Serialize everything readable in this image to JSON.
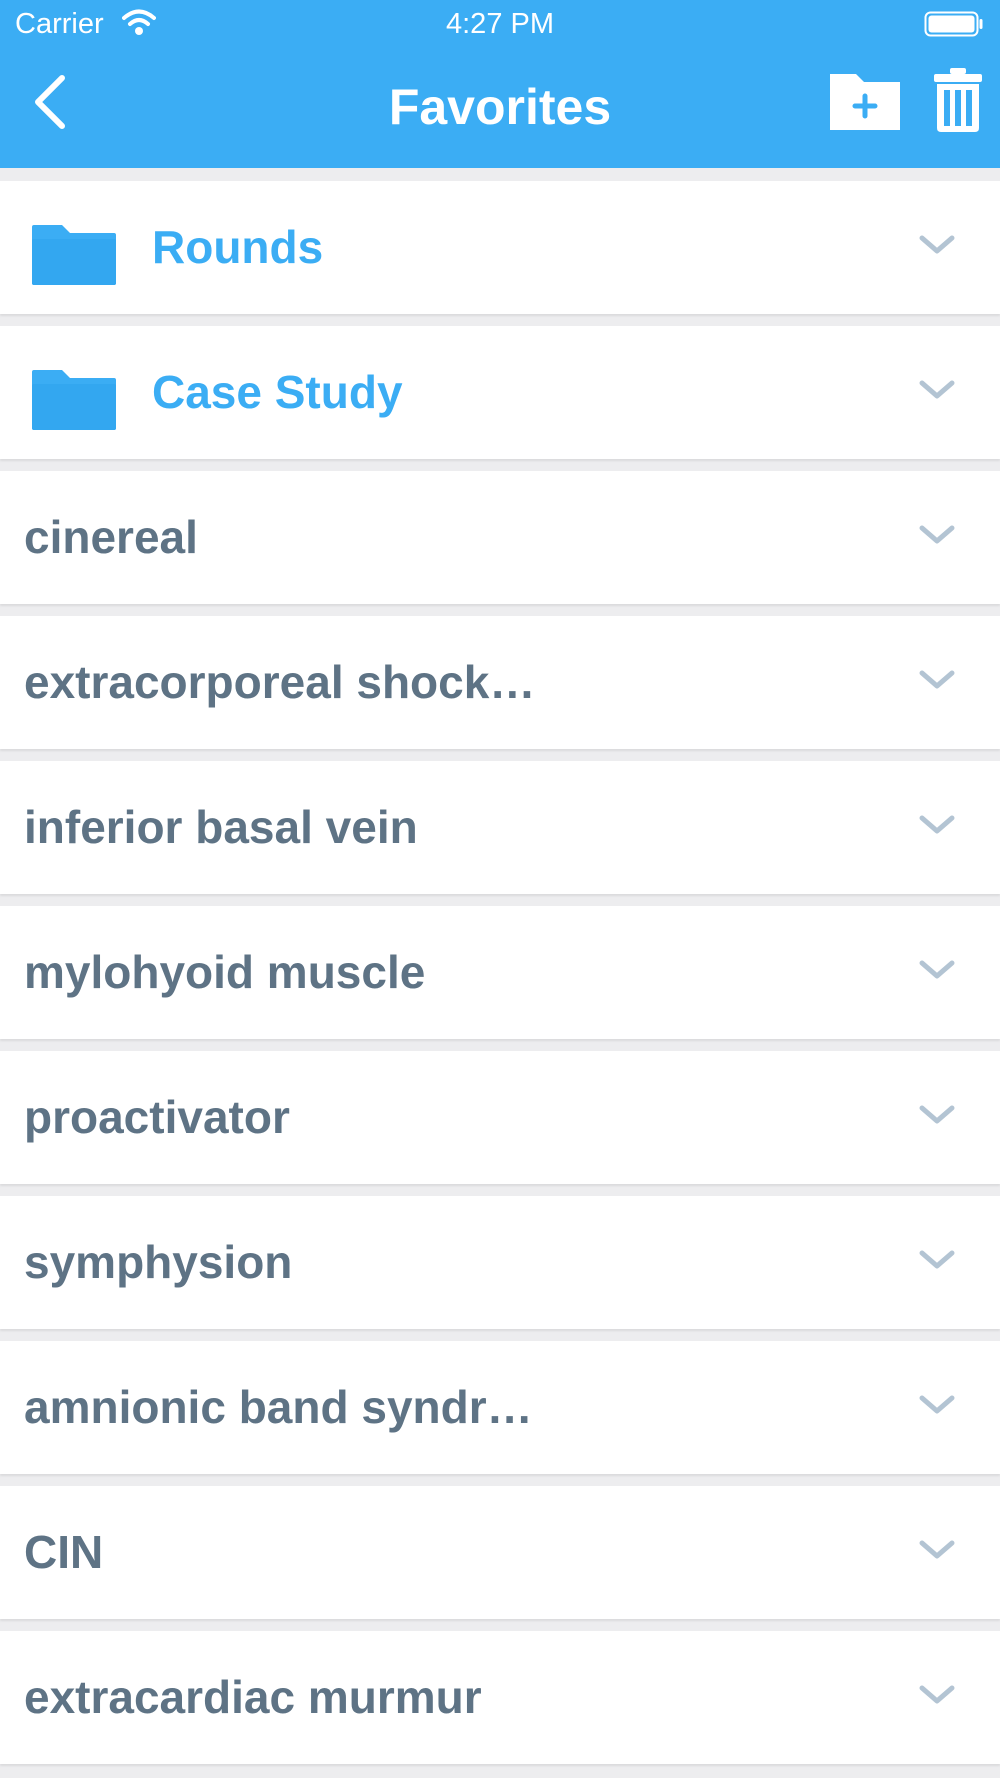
{
  "status_bar": {
    "carrier": "Carrier",
    "time": "4:27 PM",
    "icons": [
      "wifi-icon",
      "battery-icon"
    ]
  },
  "nav": {
    "title": "Favorites",
    "back_icon": "chevron-left-icon",
    "actions": [
      "new-folder-icon",
      "trash-icon"
    ]
  },
  "folders": [
    {
      "label": "Rounds"
    },
    {
      "label": "Case Study"
    }
  ],
  "items": [
    {
      "label": "cinereal"
    },
    {
      "label": "extracorporeal shock…"
    },
    {
      "label": "inferior basal vein"
    },
    {
      "label": "mylohyoid muscle"
    },
    {
      "label": "proactivator"
    },
    {
      "label": "symphysion"
    },
    {
      "label": "amnionic band syndr…"
    },
    {
      "label": "CIN"
    },
    {
      "label": "extracardiac murmur"
    }
  ],
  "colors": {
    "accent": "#3badf4",
    "item_text": "#5e7385",
    "chevron": "#b3c4d3",
    "background": "#ededef"
  }
}
